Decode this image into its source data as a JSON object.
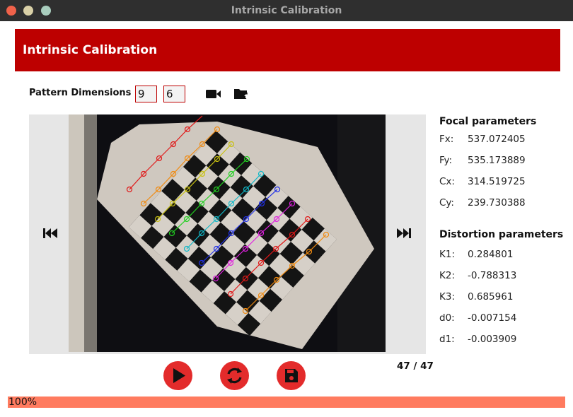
{
  "window": {
    "title": "Intrinsic Calibration"
  },
  "header": {
    "title": "Intrinsic Calibration"
  },
  "pattern": {
    "label": "Pattern Dimensions",
    "rows": "9",
    "cols": "6"
  },
  "toolbar": {
    "camera_icon": "video-camera-icon",
    "folder_icon": "folder-open-icon"
  },
  "viewer": {
    "prev_icon": "skip-backward-icon",
    "next_icon": "skip-forward-icon",
    "counter": "47 / 47"
  },
  "focal": {
    "title": "Focal parameters",
    "params": [
      {
        "name": "Fx:",
        "value": "537.072405"
      },
      {
        "name": "Fy:",
        "value": "535.173889"
      },
      {
        "name": "Cx:",
        "value": "314.519725"
      },
      {
        "name": "Cy:",
        "value": "239.730388"
      }
    ]
  },
  "distortion": {
    "title": "Distortion parameters",
    "params": [
      {
        "name": "K1:",
        "value": "0.284801"
      },
      {
        "name": "K2:",
        "value": "-0.788313"
      },
      {
        "name": "K3:",
        "value": "0.685961"
      },
      {
        "name": "d0:",
        "value": "-0.007154"
      },
      {
        "name": "d1:",
        "value": "-0.003909"
      }
    ]
  },
  "controls": {
    "play_icon": "play-icon",
    "refresh_icon": "refresh-icon",
    "save_icon": "save-icon"
  },
  "progress": {
    "value": 1.0,
    "text": "100%"
  },
  "colors": {
    "header": "#bd0000",
    "button": "#e32b2b",
    "progress": "#ff7b5f"
  }
}
